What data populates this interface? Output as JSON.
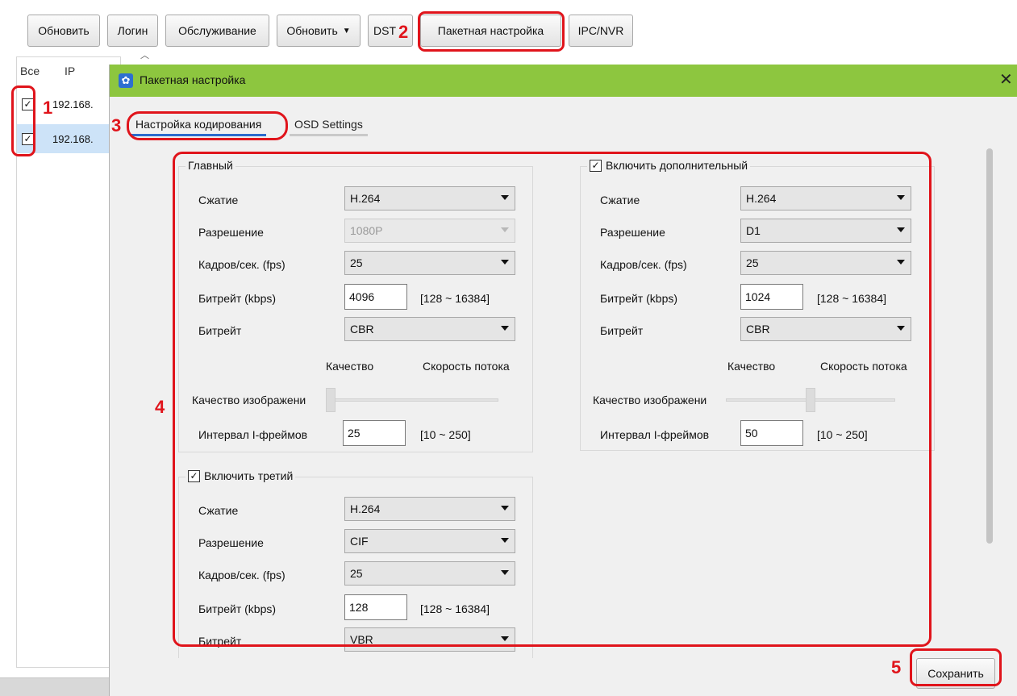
{
  "toolbar": {
    "refresh": "Обновить",
    "login": "Логин",
    "maintenance": "Обслуживание",
    "update": "Обновить",
    "dst": "DST",
    "batch": "Пакетная настройка",
    "ipc": "IPC/NVR"
  },
  "list": {
    "col_all": "Все",
    "col_ip": "IP",
    "rows": [
      {
        "ip": "192.168.",
        "checked": true,
        "selected": false
      },
      {
        "ip": "192.168.",
        "checked": true,
        "selected": true
      }
    ]
  },
  "dialog": {
    "title": "Пакетная настройка",
    "close": "✕",
    "tabs": [
      "Настройка кодирования",
      "OSD Settings"
    ],
    "save": "Сохранить"
  },
  "main": {
    "legend": "Главный",
    "compression_label": "Сжатие",
    "compression": "H.264",
    "resolution_label": "Разрешение",
    "resolution": "1080P",
    "fps_label": "Кадров/сек. (fps)",
    "fps": "25",
    "bitrate_label": "Битрейт (kbps)",
    "bitrate": "4096",
    "bitrate_range": "[128 ~ 16384]",
    "bitrate_type_label": "Битрейт",
    "bitrate_type": "CBR",
    "quality_label": "Качество",
    "speed_label": "Скорость потока",
    "image_quality_label": "Качество изображени",
    "image_quality_level": 0.0,
    "iframe_label": "Интервал I-фреймов",
    "iframe": "25",
    "iframe_range": "[10 ~ 250]"
  },
  "extra": {
    "legend": "Включить дополнительный",
    "enabled": true,
    "compression_label": "Сжатие",
    "compression": "H.264",
    "resolution_label": "Разрешение",
    "resolution": "D1",
    "fps_label": "Кадров/сек. (fps)",
    "fps": "25",
    "bitrate_label": "Битрейт (kbps)",
    "bitrate": "1024",
    "bitrate_range": "[128 ~ 16384]",
    "bitrate_type_label": "Битрейт",
    "bitrate_type": "CBR",
    "quality_label": "Качество",
    "speed_label": "Скорость потока",
    "image_quality_label": "Качество изображени",
    "image_quality_level": 0.5,
    "iframe_label": "Интервал I-фреймов",
    "iframe": "50",
    "iframe_range": "[10 ~ 250]"
  },
  "third": {
    "legend": "Включить третий",
    "enabled": true,
    "compression_label": "Сжатие",
    "compression": "H.264",
    "resolution_label": "Разрешение",
    "resolution": "CIF",
    "fps_label": "Кадров/сек. (fps)",
    "fps": "25",
    "bitrate_label": "Битрейт (kbps)",
    "bitrate": "128",
    "bitrate_range": "[128 ~ 16384]",
    "bitrate_type_label": "Битрейт",
    "bitrate_type": "VBR"
  },
  "annotations": [
    "1",
    "2",
    "3",
    "4",
    "5"
  ],
  "colors": {
    "titlebar": "#8dc63f",
    "annotation": "#e0141b",
    "tab_active": "#2b6bcd",
    "selected_row": "#cde3f8"
  }
}
